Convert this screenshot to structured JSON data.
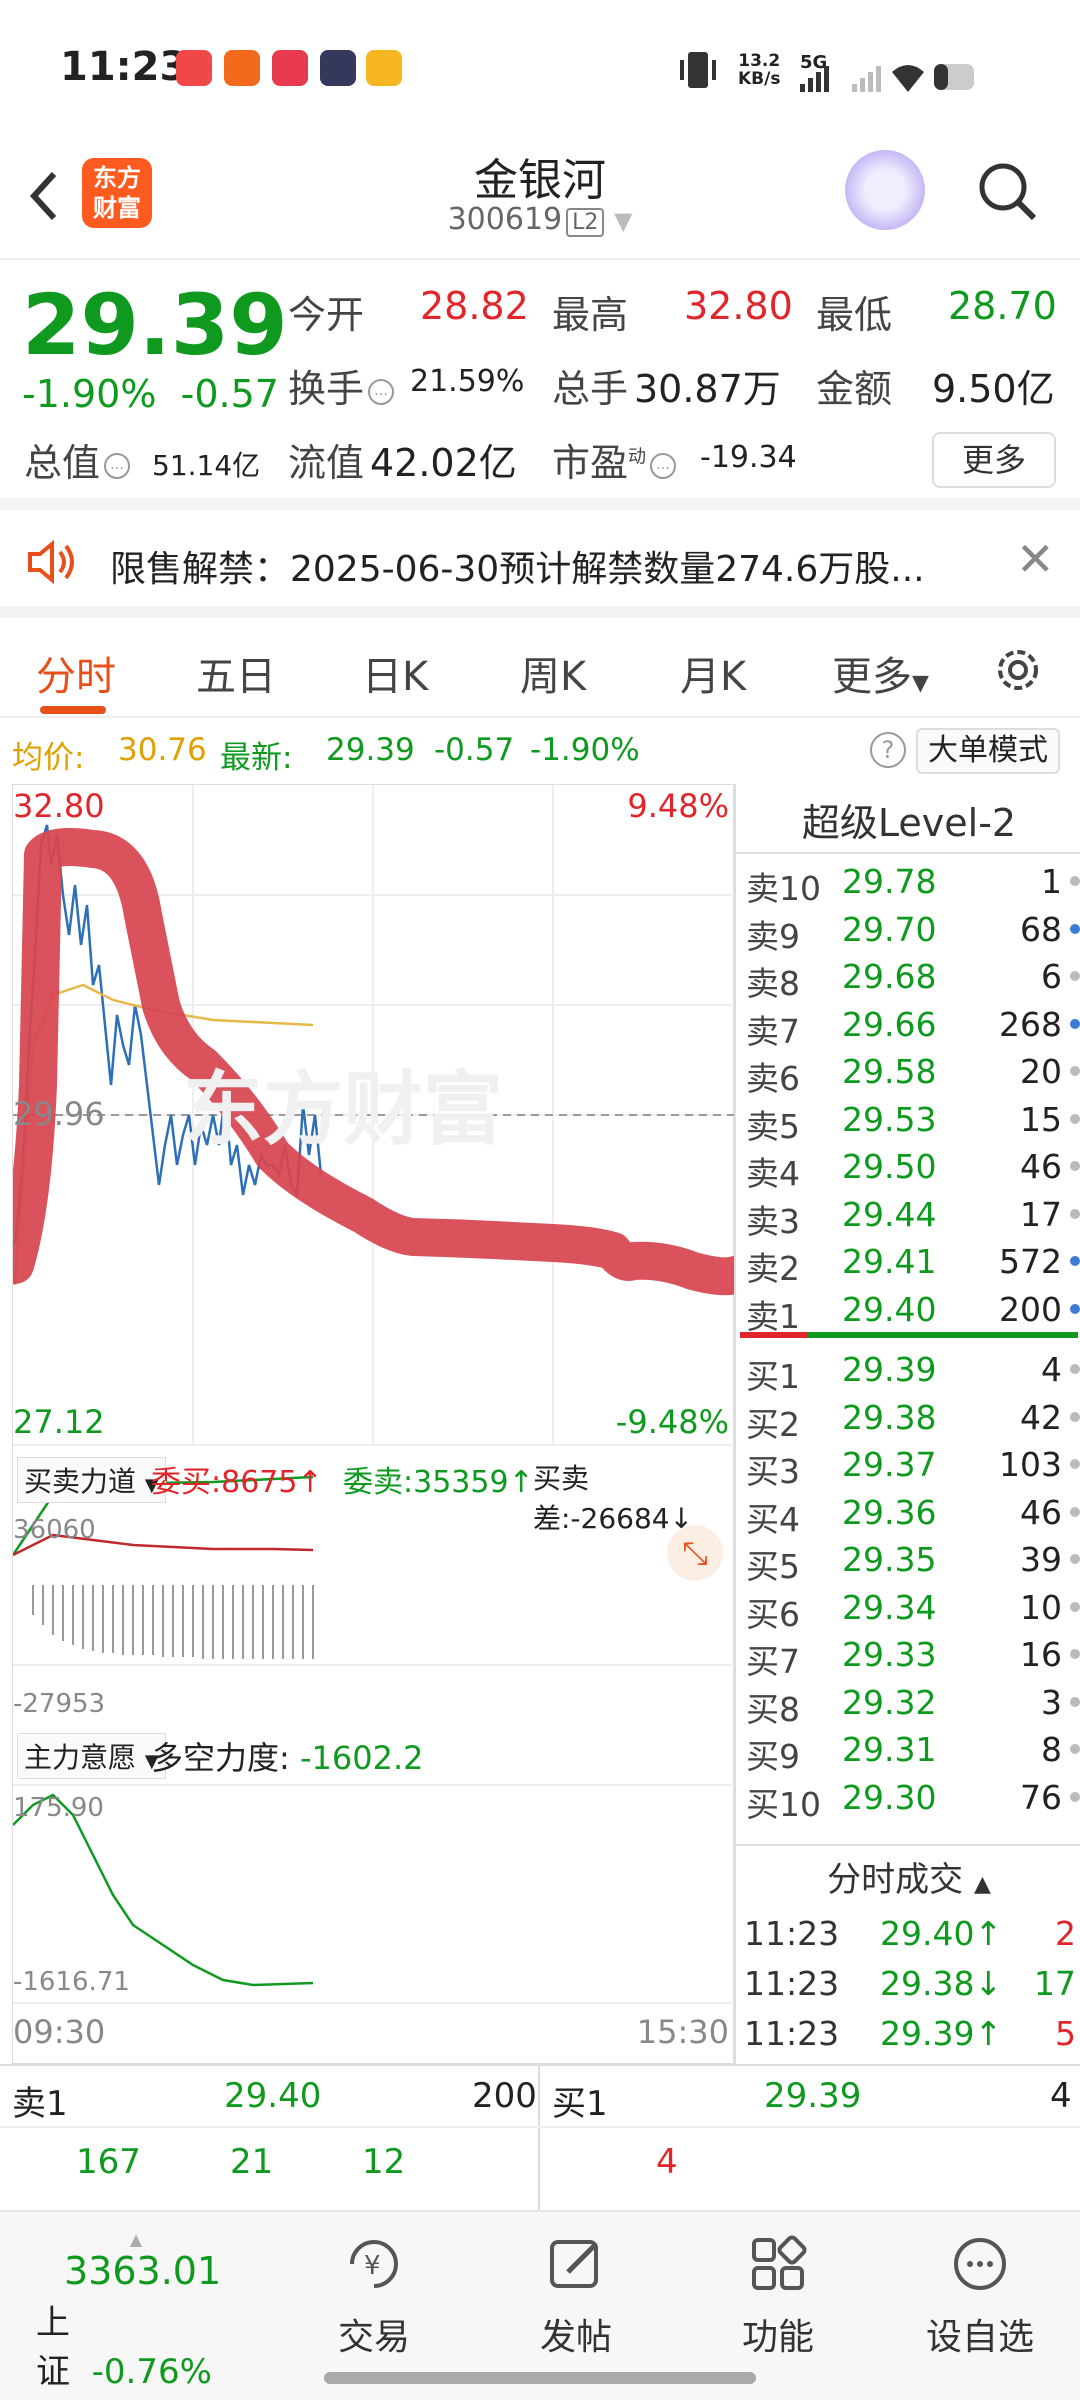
{
  "status_bar": {
    "time": "11:23",
    "net_speed": "13.2",
    "net_unit": "KB/s",
    "net_type": "5G"
  },
  "header": {
    "name": "金银河",
    "code": "300619",
    "level": "L2",
    "logo_line1": "东方",
    "logo_line2": "财富"
  },
  "quote": {
    "price": "29.39",
    "change_pct": "-1.90%",
    "change": "-0.57",
    "open_label": "今开",
    "open": "28.82",
    "high_label": "最高",
    "high": "32.80",
    "low_label": "最低",
    "low": "28.70",
    "turnover_label": "换手",
    "turnover": "21.59%",
    "volume_label": "总手",
    "volume": "30.87万",
    "amount_label": "金额",
    "amount": "9.50亿",
    "mktcap_label": "总值",
    "mktcap": "51.14亿",
    "float_label": "流值",
    "float": "42.02亿",
    "pe_label": "市盈",
    "pe_sup": "动",
    "pe": "-19.34",
    "more": "更多"
  },
  "notice": {
    "text": "限售解禁：2025-06-30预计解禁数量274.6万股..."
  },
  "tabs": [
    "分时",
    "五日",
    "日K",
    "周K",
    "月K",
    "更多"
  ],
  "avg_row": {
    "avg_label": "均价:",
    "avg": "30.76",
    "latest_label": "最新:",
    "latest": "29.39",
    "chg": "-0.57",
    "pct": "-1.90%",
    "mode": "大单模式"
  },
  "chart": {
    "top_price": "32.80",
    "top_pct": "9.48%",
    "mid_price": "29.96",
    "bottom_price": "27.12",
    "bottom_pct": "-9.48%",
    "indicator1": "买卖力道",
    "wei_buy": "委买:8675↑",
    "wei_sell": "委卖:35359↑",
    "diff": "买卖差:-26684↓",
    "ind1_top": "36060",
    "ind1_bottom": "-27953",
    "indicator2": "主力意愿",
    "force": "多空力度:",
    "force_val": "-1602.2",
    "ind2_top": "175.90",
    "ind2_bottom": "-1616.71",
    "time_start": "09:30",
    "time_end": "15:30",
    "watermark": "东方财富"
  },
  "book": {
    "title": "超级Level-2",
    "asks": [
      {
        "label": "卖10",
        "price": "29.78",
        "vol": "1",
        "dot": "#bbbbbb"
      },
      {
        "label": "卖9",
        "price": "29.70",
        "vol": "68",
        "dot": "#3a7bd5"
      },
      {
        "label": "卖8",
        "price": "29.68",
        "vol": "6",
        "dot": "#bbbbbb"
      },
      {
        "label": "卖7",
        "price": "29.66",
        "vol": "268",
        "dot": "#3a7bd5"
      },
      {
        "label": "卖6",
        "price": "29.58",
        "vol": "20",
        "dot": "#bbbbbb"
      },
      {
        "label": "卖5",
        "price": "29.53",
        "vol": "15",
        "dot": "#bbbbbb"
      },
      {
        "label": "卖4",
        "price": "29.50",
        "vol": "46",
        "dot": "#bbbbbb"
      },
      {
        "label": "卖3",
        "price": "29.44",
        "vol": "17",
        "dot": "#bbbbbb"
      },
      {
        "label": "卖2",
        "price": "29.41",
        "vol": "572",
        "dot": "#3a7bd5"
      },
      {
        "label": "卖1",
        "price": "29.40",
        "vol": "200",
        "dot": "#3a7bd5"
      }
    ],
    "bids": [
      {
        "label": "买1",
        "price": "29.39",
        "vol": "4",
        "dot": "#bbbbbb"
      },
      {
        "label": "买2",
        "price": "29.38",
        "vol": "42",
        "dot": "#bbbbbb"
      },
      {
        "label": "买3",
        "price": "29.37",
        "vol": "103",
        "dot": "#bbbbbb"
      },
      {
        "label": "买4",
        "price": "29.36",
        "vol": "46",
        "dot": "#bbbbbb"
      },
      {
        "label": "买5",
        "price": "29.35",
        "vol": "39",
        "dot": "#bbbbbb"
      },
      {
        "label": "买6",
        "price": "29.34",
        "vol": "10",
        "dot": "#bbbbbb"
      },
      {
        "label": "买7",
        "price": "29.33",
        "vol": "16",
        "dot": "#bbbbbb"
      },
      {
        "label": "买8",
        "price": "29.32",
        "vol": "3",
        "dot": "#bbbbbb"
      },
      {
        "label": "买9",
        "price": "29.31",
        "vol": "8",
        "dot": "#bbbbbb"
      },
      {
        "label": "买10",
        "price": "29.30",
        "vol": "76",
        "dot": "#bbbbbb"
      }
    ],
    "trades_title": "分时成交",
    "trades": [
      {
        "time": "11:23",
        "price": "29.40↑",
        "vol": "2",
        "color": "#e0252b"
      },
      {
        "time": "11:23",
        "price": "29.38↓",
        "vol": "17",
        "color": "#0f9a1f"
      },
      {
        "time": "11:23",
        "price": "29.39↑",
        "vol": "5",
        "color": "#e0252b"
      }
    ]
  },
  "bottom_quote": {
    "sell_label": "卖1",
    "sell_price": "29.40",
    "sell_vol": "200",
    "buy_label": "买1",
    "buy_price": "29.39",
    "buy_vol": "4",
    "sell_q1": "167",
    "sell_q2": "21",
    "sell_q3": "12",
    "buy_q1": "4"
  },
  "nav": {
    "index_value": "3363.01",
    "index_name": "上证",
    "index_pct": "-0.76%",
    "items": [
      "交易",
      "发帖",
      "功能",
      "设自选"
    ]
  }
}
